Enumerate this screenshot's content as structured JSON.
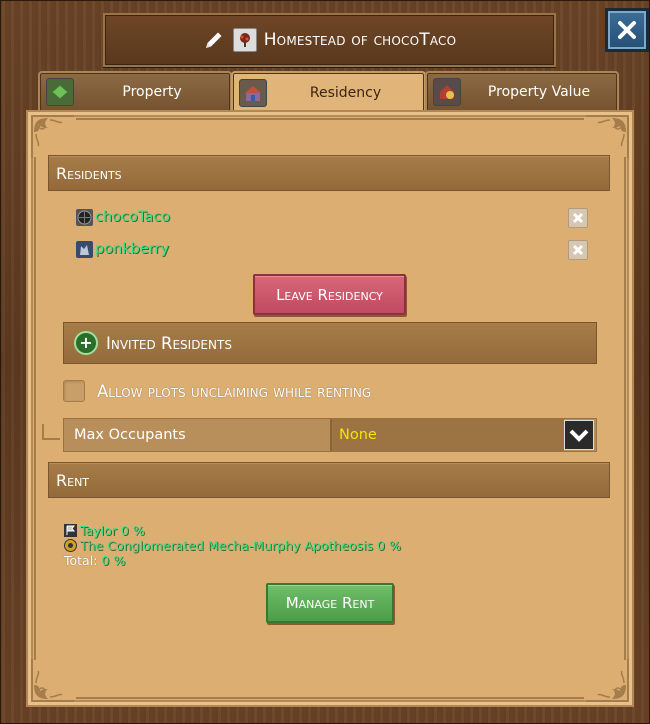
{
  "window": {
    "title": "Homestead of chocoTaco",
    "close_label": "Close"
  },
  "tabs": [
    {
      "label": "Property",
      "active": false
    },
    {
      "label": "Residency",
      "active": true
    },
    {
      "label": "Property Value",
      "active": false
    }
  ],
  "residents": {
    "heading": "Residents",
    "list": [
      {
        "name": "chocoTaco",
        "icon": "globe-icon"
      },
      {
        "name": "ponkberry",
        "icon": "wolf-icon"
      }
    ],
    "leave_button": "Leave Residency",
    "invited_label": "Invited Residents",
    "allow_unclaim_label": "Allow plots unclaiming while renting",
    "allow_unclaim_checked": false,
    "max_occupants_label": "Max Occupants",
    "max_occupants_value": "None"
  },
  "rent": {
    "heading": "Rent",
    "entries": [
      {
        "name": "Taylor",
        "amount": "0 %",
        "icon": "flag-icon"
      },
      {
        "name": "The Conglomerated Mecha-Murphy Apotheosis",
        "amount": "0 %",
        "icon": "gear-badge-icon"
      }
    ],
    "total_label": "Total:",
    "total_value": "0 %",
    "manage_button": "Manage Rent"
  },
  "colors": {
    "panel_bg": "#dcae72",
    "name_green": "#3ce08a",
    "value_yellow": "#f5e400",
    "leave_red": "#c04a5f",
    "manage_green": "#4d9c48"
  }
}
